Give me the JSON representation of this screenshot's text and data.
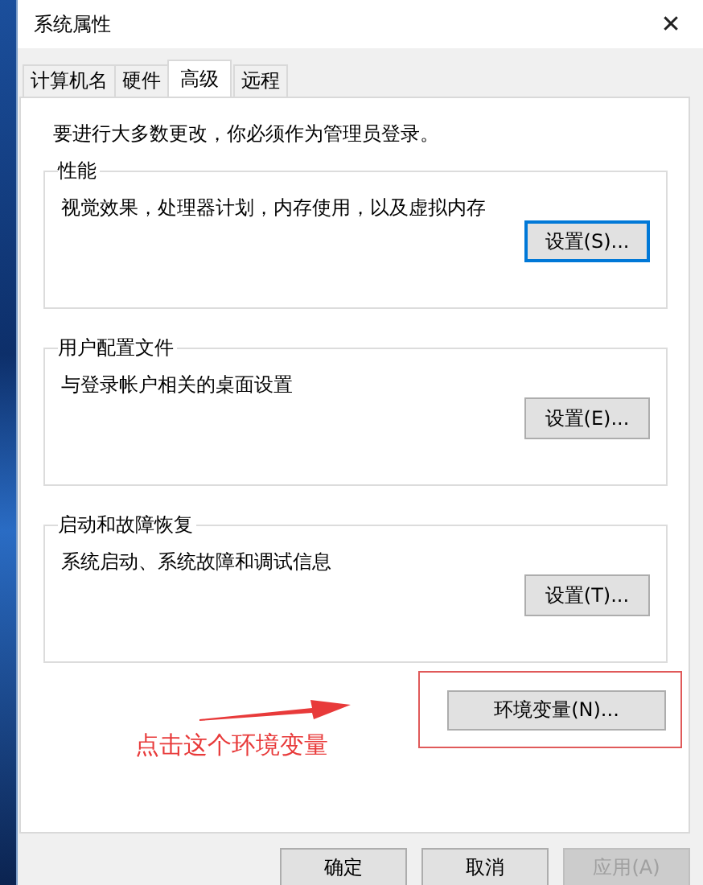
{
  "window": {
    "title": "系统属性",
    "close": "✕"
  },
  "tabs": [
    {
      "label": "计算机名",
      "selected": false
    },
    {
      "label": "硬件",
      "selected": false
    },
    {
      "label": "高级",
      "selected": true
    },
    {
      "label": "远程",
      "selected": false
    }
  ],
  "notice": "要进行大多数更改，你必须作为管理员登录。",
  "groups": [
    {
      "title": "性能",
      "description": "视觉效果，处理器计划，内存使用，以及虚拟内存",
      "button": "设置(S)...",
      "focused": true
    },
    {
      "title": "用户配置文件",
      "description": "与登录帐户相关的桌面设置",
      "button": "设置(E)...",
      "focused": false
    },
    {
      "title": "启动和故障恢复",
      "description": "系统启动、系统故障和调试信息",
      "button": "设置(T)...",
      "focused": false
    }
  ],
  "env_button": "环境变量(N)...",
  "annotation": "点击这个环境变量",
  "buttons": [
    {
      "label": "确定",
      "disabled": false
    },
    {
      "label": "取消",
      "disabled": false
    },
    {
      "label": "应用(A)",
      "disabled": true
    }
  ]
}
